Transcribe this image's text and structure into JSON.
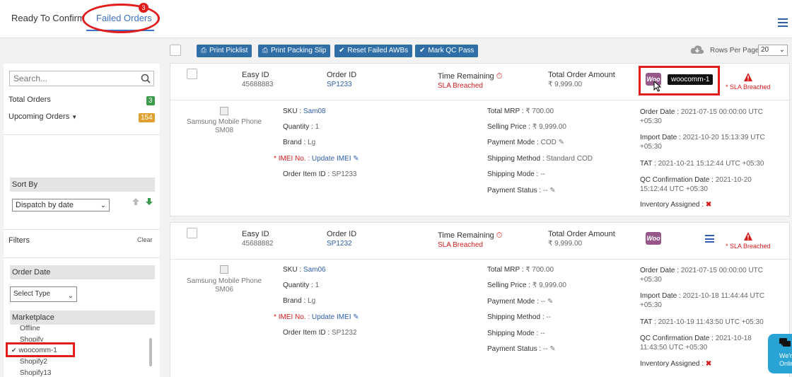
{
  "tabs": {
    "ready": "Ready To Confirm",
    "failed": "Failed Orders",
    "failed_badge": "3"
  },
  "actions": {
    "print_picklist": "Print Picklist",
    "print_packing_slip": "Print Packing Slip",
    "reset_failed_awbs": "Reset Failed AWBs",
    "mark_qc_pass": "Mark QC Pass",
    "rows_per_page_label": "Rows Per Page",
    "rows_per_page_value": "20"
  },
  "sidebar": {
    "search_placeholder": "Search...",
    "total_orders_label": "Total Orders",
    "total_orders_count": "3",
    "upcoming_orders_label": "Upcoming Orders",
    "upcoming_orders_count": "154",
    "sort_by_label": "Sort By",
    "sort_by_value": "Dispatch by date",
    "filters_label": "Filters",
    "clear_label": "Clear",
    "order_date_label": "Order Date",
    "select_type": "Select Type",
    "marketplace_label": "Marketplace",
    "marketplaces": [
      "Offline",
      "Shopify",
      "woocomm-1",
      "Shopify2",
      "Shopify13"
    ],
    "selected_marketplace": "woocomm-1"
  },
  "labels": {
    "easy_id": "Easy ID",
    "order_id": "Order ID",
    "time_remaining": "Time Remaining",
    "total_order_amount": "Total Order Amount",
    "sla_breached_small": "* SLA Breached",
    "sku": "SKU :",
    "quantity": "Quantity :",
    "brand": "Brand :",
    "imei": "IMEI No. :",
    "update_imei": "Update IMEI",
    "order_item_id": "Order Item ID :",
    "total_mrp": "Total MRP :",
    "selling_price": "Selling Price :",
    "payment_mode": "Payment Mode :",
    "shipping_method": "Shipping Method :",
    "shipping_mode": "Shipping Mode :",
    "payment_status": "Payment Status :",
    "order_date": "Order Date :",
    "import_date": "Import Date :",
    "tat": "TAT :",
    "qc_confirmation_date": "QC Confirmation Date :",
    "inventory_assigned": "Inventory Assigned :",
    "woo_icon_text": "Woo",
    "tooltip": "woocomm-1"
  },
  "orders": [
    {
      "easy_id": "45688883",
      "order_id": "SP1233",
      "time_remaining": "SLA Breached",
      "total_amount": "₹ 9,999.00",
      "product_line1": "Samsung Mobile Phone",
      "product_line2": "SM08",
      "sku": "Sam08",
      "quantity": "1",
      "brand": "Lg",
      "order_item_id": "SP1233",
      "total_mrp": "₹ 700.00",
      "selling_price": "₹ 9,999.00",
      "payment_mode": "COD",
      "shipping_method": "Standard COD",
      "shipping_mode": "--",
      "payment_status": "--",
      "order_date_l1": "2021-07-15 00:00:00 UTC",
      "order_date_l2": "+05:30",
      "import_date_l1": "2021-10-20 15:13:39 UTC",
      "import_date_l2": "+05:30",
      "tat": "2021-10-21 15:12:44 UTC +05:30",
      "qc_date_l1": "2021-10-20",
      "qc_date_l2": "15:12:44 UTC +05:30"
    },
    {
      "easy_id": "45688882",
      "order_id": "SP1232",
      "time_remaining": "SLA Breached",
      "total_amount": "₹ 9,999.00",
      "product_line1": "Samsung Mobile Phone",
      "product_line2": "SM06",
      "sku": "Sam06",
      "quantity": "1",
      "brand": "Lg",
      "order_item_id": "SP1232",
      "total_mrp": "₹ 700.00",
      "selling_price": "₹ 9,999.00",
      "payment_mode": "--",
      "shipping_method": "--",
      "shipping_mode": "--",
      "payment_status": "--",
      "order_date_l1": "2021-07-15 00:00:00 UTC",
      "order_date_l2": "+05:30",
      "import_date_l1": "2021-10-18 11:44:44 UTC",
      "import_date_l2": "+05:30",
      "tat": "2021-10-19 11:43:50 UTC +05:30",
      "qc_date_l1": "2021-10-18",
      "qc_date_l2": "11:43:50 UTC +05:30"
    }
  ],
  "chat": {
    "line1": "We'r",
    "line2": "Onlin"
  },
  "colors": {
    "primary": "#2f6ea7",
    "accent_blue": "#3b72c8",
    "danger": "#d61c1c",
    "woo_purple": "#96588a",
    "badge_green": "#3a9b4a",
    "badge_orange": "#e0a030"
  }
}
